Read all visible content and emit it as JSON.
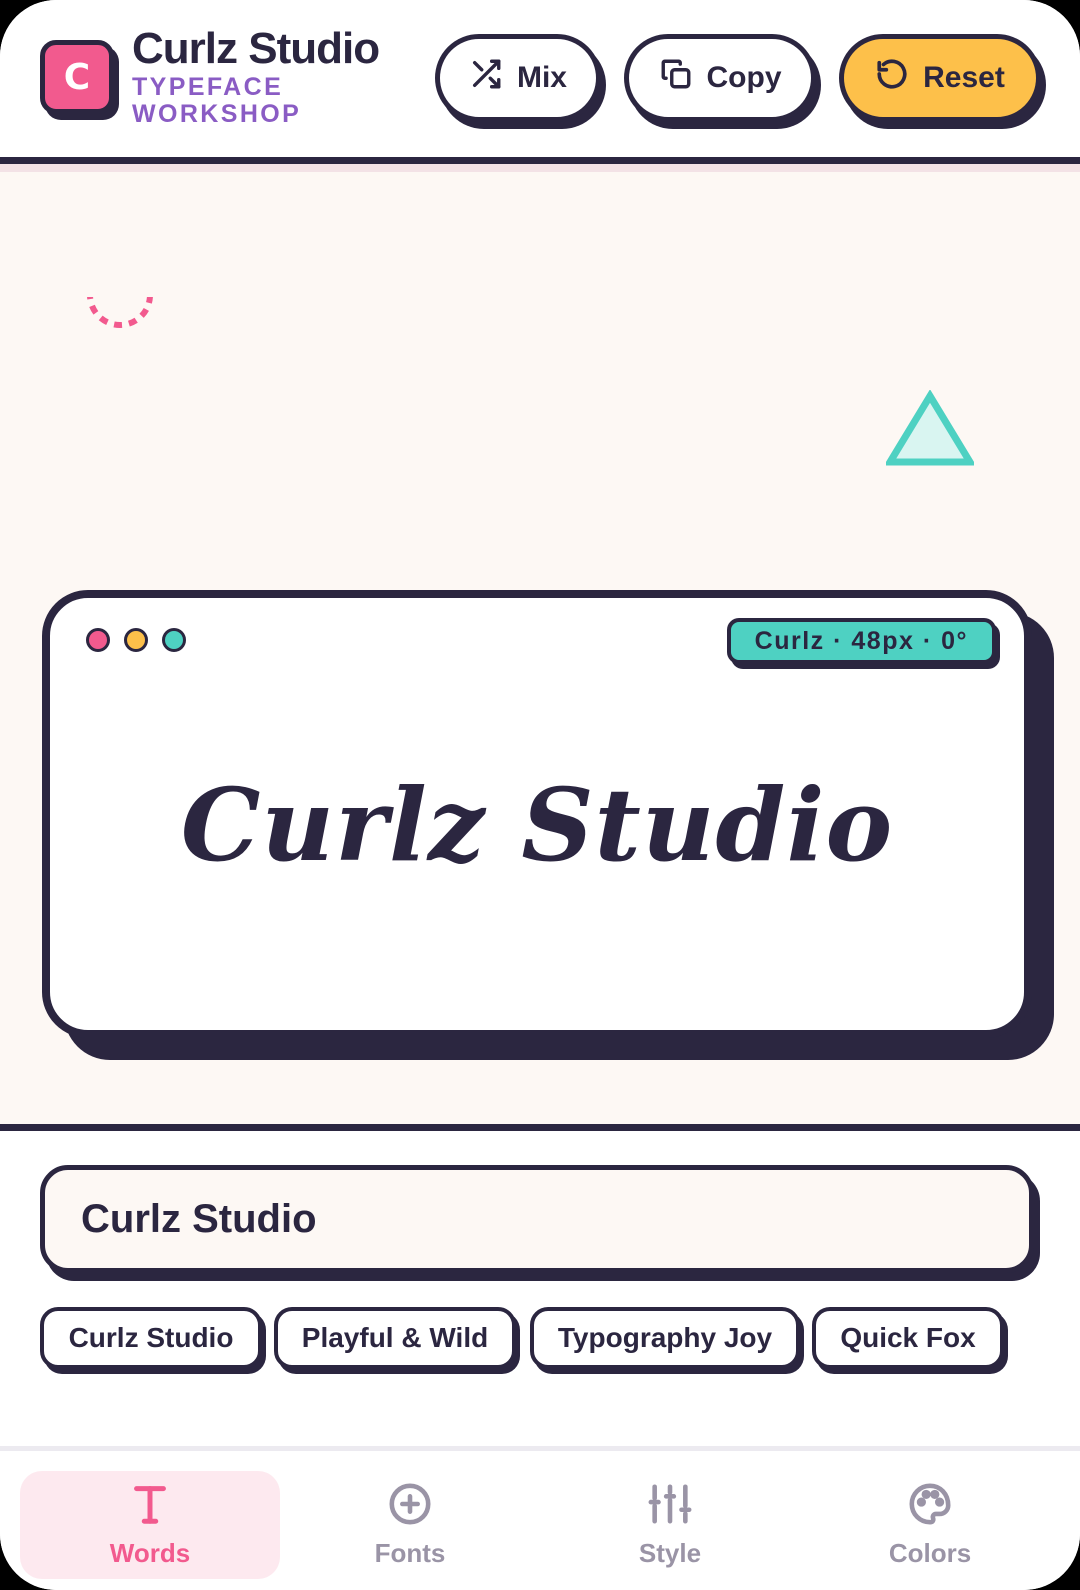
{
  "app": {
    "logo_letter": "C",
    "title": "Curlz Studio",
    "subtitle": "TYPEFACE WORKSHOP"
  },
  "toolbar": {
    "mix_label": "Mix",
    "copy_label": "Copy",
    "reset_label": "Reset"
  },
  "preview": {
    "meta_chip": "Curlz · 48px · 0°",
    "text": "Curlz Studio"
  },
  "input": {
    "value": "Curlz Studio"
  },
  "presets": [
    "Curlz Studio",
    "Playful & Wild",
    "Typography Joy",
    "Quick Fox"
  ],
  "nav": {
    "items": [
      {
        "label": "Words",
        "icon": "text-icon",
        "active": true
      },
      {
        "label": "Fonts",
        "icon": "plus-circle-icon",
        "active": false
      },
      {
        "label": "Style",
        "icon": "sliders-icon",
        "active": false
      },
      {
        "label": "Colors",
        "icon": "palette-icon",
        "active": false
      }
    ]
  },
  "colors": {
    "ink": "#2b2640",
    "pink": "#f25a8e",
    "yellow": "#fdc04a",
    "teal": "#4ed1c2",
    "purple": "#8a5cc4",
    "canvas": "#fdf8f4"
  }
}
